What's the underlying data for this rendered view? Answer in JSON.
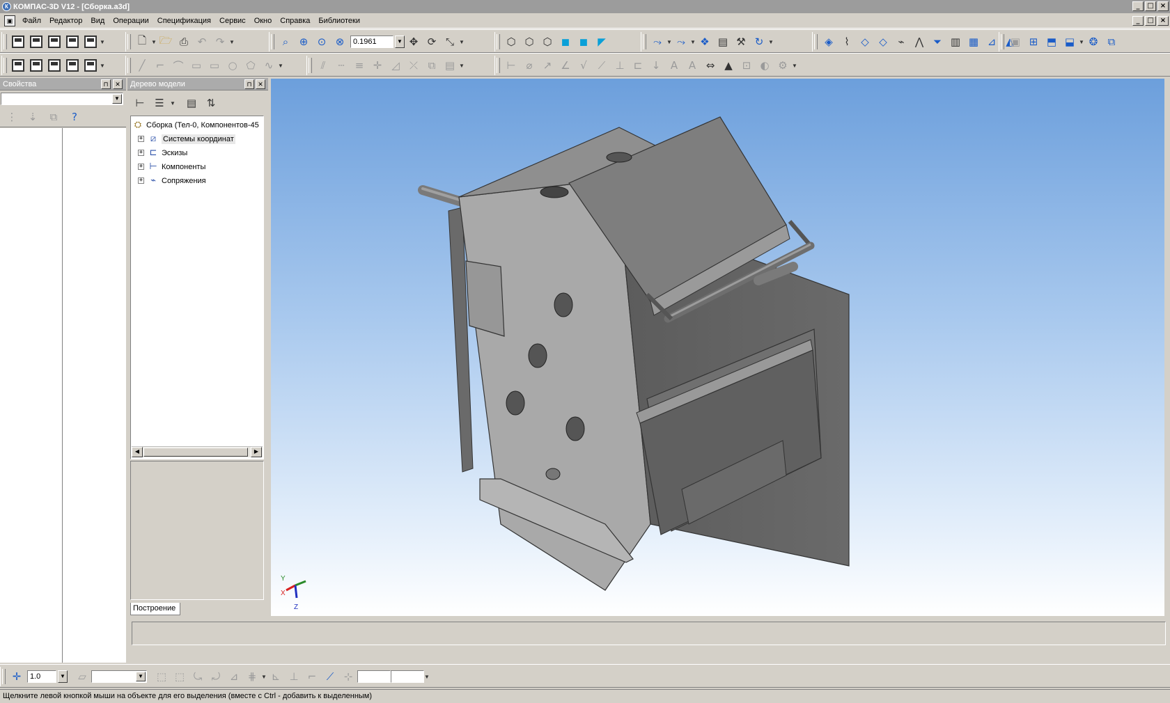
{
  "window": {
    "title": "КОМПАС-3D V12 - [Сборка.a3d]",
    "buttons": {
      "minimize": "_",
      "maximize": "□",
      "close": "×"
    }
  },
  "menu": {
    "items": [
      "Файл",
      "Редактор",
      "Вид",
      "Операции",
      "Спецификация",
      "Сервис",
      "Окно",
      "Справка",
      "Библиотеки"
    ]
  },
  "toolbar": {
    "scale_value": "0.1961"
  },
  "properties_panel": {
    "title": "Свойства"
  },
  "model_tree": {
    "title": "Дерево модели",
    "root": "Сборка (Тел-0, Компонентов-45",
    "items": [
      {
        "label": "Системы координат",
        "icon": "coordinate-systems-icon"
      },
      {
        "label": "Эскизы",
        "icon": "sketches-icon"
      },
      {
        "label": "Компоненты",
        "icon": "components-icon"
      },
      {
        "label": "Сопряжения",
        "icon": "mates-icon"
      }
    ],
    "tab_label": "Построение"
  },
  "axes": {
    "y": "Y",
    "x": "X",
    "z": "Z"
  },
  "bottom_toolbar": {
    "step_value": "1.0"
  },
  "status": {
    "message": "Щелкните левой кнопкой мыши на объекте для его выделения (вместе с Ctrl - добавить к выделенным)"
  }
}
